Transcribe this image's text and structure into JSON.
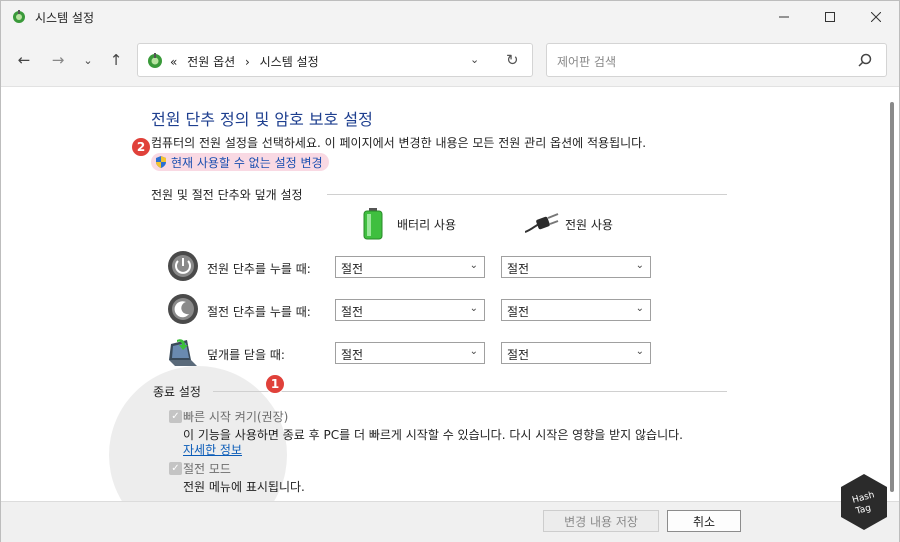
{
  "window": {
    "title": "시스템 설정"
  },
  "nav": {
    "back": "←",
    "forward": "→",
    "recent": "⌄",
    "up": "↑",
    "breadcrumb_prefix": "«",
    "breadcrumb": [
      "전원 옵션",
      "시스템 설정"
    ],
    "separator": "›",
    "refresh": "↻",
    "search_placeholder": "제어판 검색"
  },
  "main": {
    "heading": "전원 단추 정의 및 암호 보호 설정",
    "description": "컴퓨터의 전원 설정을 선택하세요. 이 페이지에서 변경한 내용은 모든 전원 관리 옵션에 적용됩니다.",
    "change_link": "현재 사용할 수 없는 설정 변경",
    "badge_2": "2",
    "badge_1": "1",
    "section_power": "전원 및 절전 단추와 덮개 설정",
    "col_battery": "배터리 사용",
    "col_plugged": "전원 사용",
    "rows": [
      {
        "label": "전원 단추를 누를 때:",
        "battery": "절전",
        "plugged": "절전"
      },
      {
        "label": "절전 단추를 누를 때:",
        "battery": "절전",
        "plugged": "절전"
      },
      {
        "label": "덮개를 닫을 때:",
        "battery": "절전",
        "plugged": "절전"
      }
    ],
    "section_shutdown": "종료 설정",
    "fast_startup_label": "빠른 시작 켜기(권장)",
    "fast_startup_desc": "이 기능을 사용하면 종료 후 PC를 더 빠르게 시작할 수 있습니다. 다시 시작은 영향을 받지 않습니다.",
    "more_info": "자세한 정보",
    "sleep_label": "절전 모드",
    "sleep_desc": "전원 메뉴에 표시됩니다."
  },
  "footer": {
    "save": "변경 내용 저장",
    "cancel": "취소"
  },
  "colors": {
    "heading": "#1e3f8f",
    "link": "#0b5cb8",
    "highlight": "#f9d9e3",
    "badge": "#e0413a"
  }
}
